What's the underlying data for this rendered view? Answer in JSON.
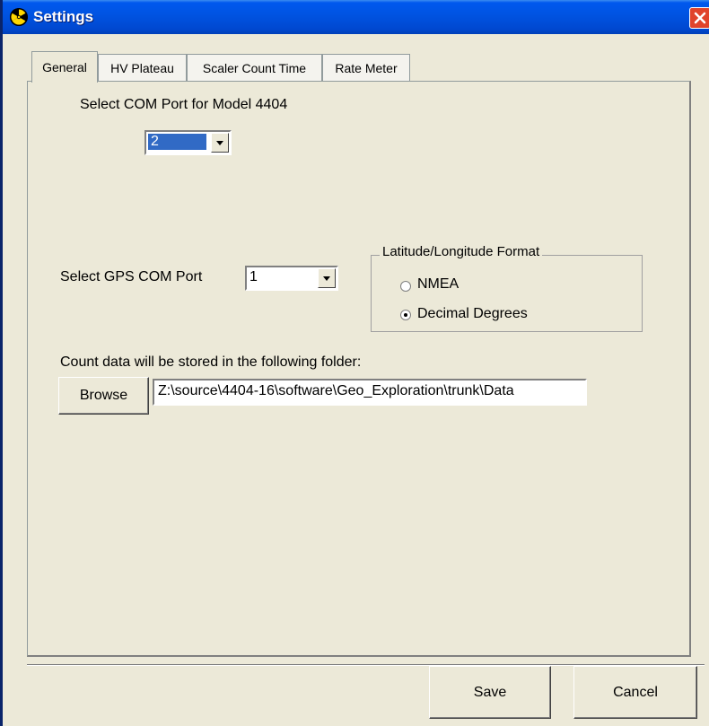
{
  "window": {
    "title": "Settings",
    "icon": "radiation-icon",
    "accent": "#0054E3"
  },
  "tabs": [
    {
      "label": "General",
      "active": true
    },
    {
      "label": "HV Plateau",
      "active": false
    },
    {
      "label": "Scaler Count Time",
      "active": false
    },
    {
      "label": "Rate Meter",
      "active": false
    }
  ],
  "general": {
    "com_port_label": "Select COM Port for Model 4404",
    "com_port_value": "2",
    "gps_label": "Select GPS COM Port",
    "gps_value": "1",
    "latlon": {
      "title": "Latitude/Longitude Format",
      "options": [
        "NMEA",
        "Decimal Degrees"
      ],
      "selected": "Decimal Degrees"
    },
    "folder_label": "Count data will be stored in the following folder:",
    "browse_label": "Browse",
    "folder_path": "Z:\\source\\4404-16\\software\\Geo_Exploration\\trunk\\Data"
  },
  "footer": {
    "save_label": "Save",
    "cancel_label": "Cancel"
  }
}
